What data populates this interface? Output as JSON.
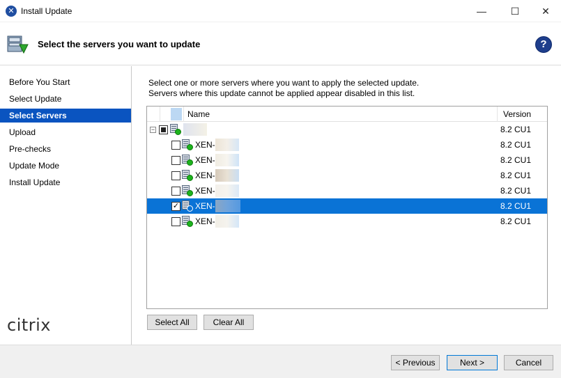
{
  "window": {
    "title": "Install Update",
    "minimize_glyph": "—",
    "maximize_glyph": "☐",
    "close_glyph": "✕"
  },
  "header": {
    "title": "Select the servers you want to update",
    "help_glyph": "?"
  },
  "sidebar": {
    "items": [
      {
        "label": "Before You Start",
        "active": false
      },
      {
        "label": "Select Update",
        "active": false
      },
      {
        "label": "Select Servers",
        "active": true
      },
      {
        "label": "Upload",
        "active": false
      },
      {
        "label": "Pre-checks",
        "active": false
      },
      {
        "label": "Update Mode",
        "active": false
      },
      {
        "label": "Install Update",
        "active": false
      }
    ],
    "logo": "citrix"
  },
  "main": {
    "description_line1": "Select one or more servers where you want to apply the selected update.",
    "description_line2": "Servers where this update cannot be applied appear disabled in this list."
  },
  "grid": {
    "columns": {
      "name": "Name",
      "version": "Version"
    },
    "pool": {
      "name": "",
      "version": "8.2 CU1",
      "checkbox": "partial",
      "expander": "−"
    },
    "servers": [
      {
        "name": "XEN-",
        "version": "8.2 CU1",
        "checked": false,
        "selected": false
      },
      {
        "name": "XEN-",
        "version": "8.2 CU1",
        "checked": false,
        "selected": false
      },
      {
        "name": "XEN-",
        "version": "8.2 CU1",
        "checked": false,
        "selected": false
      },
      {
        "name": "XEN-",
        "version": "8.2 CU1",
        "checked": false,
        "selected": false
      },
      {
        "name": "XEN-",
        "version": "8.2 CU1",
        "checked": true,
        "selected": true
      },
      {
        "name": "XEN-",
        "version": "8.2 CU1",
        "checked": false,
        "selected": false
      }
    ]
  },
  "buttons": {
    "select_all": "Select All",
    "clear_all": "Clear All",
    "previous": "< Previous",
    "next": "Next >",
    "cancel": "Cancel"
  },
  "colors": {
    "accent": "#0a54c0",
    "selection": "#0a73d6",
    "status_ok": "#1db31d"
  }
}
